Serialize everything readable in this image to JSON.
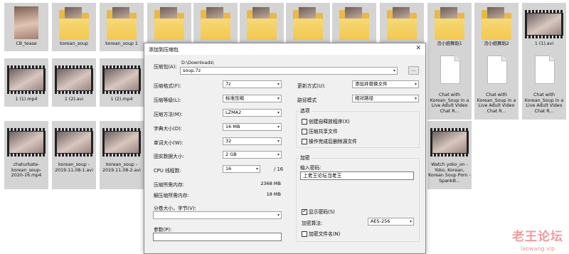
{
  "files": {
    "row1": [
      "CB_tease",
      "korean_soup",
      "korean_soup 1",
      "",
      "",
      "",
      "",
      "",
      "",
      "活小姐舞蹈1",
      "活小姐舞蹈2",
      "1 (1).avi"
    ],
    "row2": [
      "1 (1).mp4",
      "1 (2).avi",
      "1 (2).mp4"
    ],
    "row2_right": [
      "Chat with Korean_Soup in a Live Adult Video Chat R...",
      "Chat with Korean_Soup in a Live Adult Video Chat R...",
      "Chat with Korean_Soup in a Live Adult Video Chat R..."
    ],
    "row3": [
      "chaturbate-korean_soup-2020-16.mp4",
      "korean_soup - 2019.11.08-1.avi",
      "korean_soup - 2019.11.08-2.avi"
    ],
    "row3_right": "Watch yoko_on - Yoko, Korean, Korean Soup Porn - SpankB..."
  },
  "dialog": {
    "title": "添加到压缩包",
    "close": "✕",
    "archive_label": "压缩包(A):",
    "archive_path": "D:\\Downloads\\",
    "archive_name": "soup.7z",
    "browse_button": "...",
    "left": [
      {
        "label": "压缩格式(F):",
        "value": "7z"
      },
      {
        "label": "压缩等级(L):",
        "value": "标准压缩"
      },
      {
        "label": "压缩方法(M):",
        "value": "LZMA2"
      },
      {
        "label": "字典大小(D):",
        "value": "16 MB"
      },
      {
        "label": "单词大小(W):",
        "value": "32"
      },
      {
        "label": "固实数据大小:",
        "value": "2 GB"
      },
      {
        "label": "CPU 线程数:",
        "value": "16",
        "suffix": "/ 16"
      }
    ],
    "memory": [
      {
        "label": "压缩所需内存:",
        "value": "2368 MB"
      },
      {
        "label": "解压缩所需内存:",
        "value": "18 MB"
      }
    ],
    "split_label": "分卷大小，字节(V):",
    "params_label": "参数(P):",
    "right": {
      "update_label": "更新方式(U):",
      "update_value": "添加并替换文件",
      "path_label": "路径模式",
      "path_value": "相对路径",
      "options_title": "选项",
      "options": [
        "创建自释放程序(X)",
        "压缩共享文件",
        "操作完成后删除源文件"
      ],
      "encrypt_title": "加密",
      "password_label": "输入密码:",
      "password_value": "上老王论坛当老王",
      "show_password": "显示密码(S)",
      "method_label": "加密算法:",
      "method_value": "AES-256",
      "encrypt_names": "加密文件名(N)"
    }
  },
  "watermark": {
    "cn": "老王论坛",
    "en": "laowang.vip"
  },
  "colors": {
    "folder": "#f2c84f",
    "tile_bg": "#d4d4d4",
    "dialog_bg": "#f0f0f0",
    "watermark": "#e04a4a"
  }
}
